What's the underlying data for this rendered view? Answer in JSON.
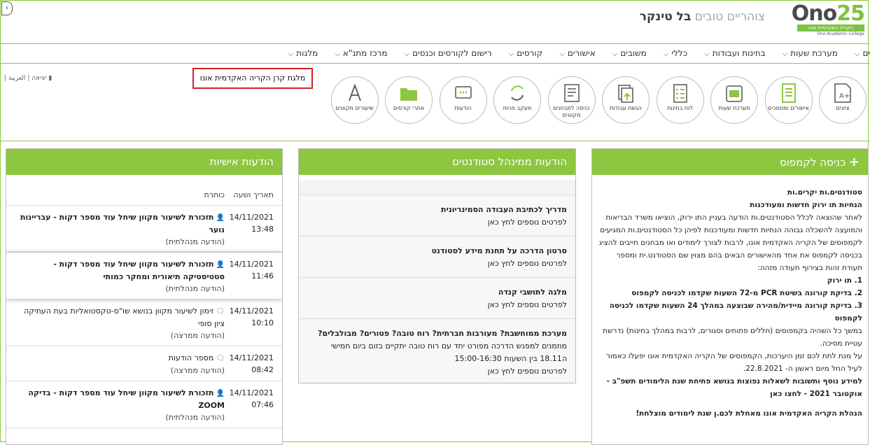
{
  "header": {
    "greeting": "צוהריים טובים",
    "user_name": "בל טינקר",
    "logo_main": "Ono",
    "logo_num": "25",
    "logo_band": "הקריה האקדמית אונו",
    "logo_sub": "Ono Academic College",
    "back_icon": "arrow-icon"
  },
  "nav": {
    "items": [
      "ציונים",
      "מערכת שעות",
      "בחינות ועבודות",
      "כללי",
      "משובים",
      "אישורים",
      "קורסים",
      "רישום לקורסים וכנסים",
      "מרכז מתנ\"א",
      "מלגות"
    ]
  },
  "tools": {
    "items": [
      {
        "label": "ציונים",
        "icon": "grades-icon"
      },
      {
        "label": "אישורים ומסמכים",
        "icon": "documents-icon"
      },
      {
        "label": "מערכת שעות",
        "icon": "timetable-icon"
      },
      {
        "label": "לוח בחינות",
        "icon": "exam-board-icon"
      },
      {
        "label": "הגשת עבודות",
        "icon": "submit-work-icon"
      },
      {
        "label": "כניסה למבחנים מקוונים",
        "icon": "online-exam-icon"
      },
      {
        "label": "מעקב פניות",
        "icon": "requests-tracking-icon"
      },
      {
        "label": "הודעות",
        "icon": "messages-icon"
      },
      {
        "label": "אתרי קורסים",
        "icon": "folder-icon"
      },
      {
        "label": "שיעורים מקוונים",
        "icon": "online-lessons-icon"
      }
    ],
    "langs": "יציאה | العربية |",
    "popup": "מלגת קרן הקריה האקדמית אונו"
  },
  "personal": {
    "title": "הודעות אישיות",
    "col_date": "תאריך ושעה",
    "col_title": "כותרת",
    "rows": [
      {
        "date": "14/11/2021",
        "time": "13:48",
        "title": "תזכורת לשיעור מקוון שיחל עוד מספר דקות - עבריינות נוער",
        "tag": "(הודעה מנהלתית)",
        "bold": true
      },
      {
        "date": "14/11/2021",
        "time": "11:46",
        "title": "תזכורת לשיעור מקוון שיחל עוד מספר דקות - סטטיסטיקה תיאורית ומחקר כמותי",
        "tag": "(הודעה מנהלתית)",
        "bold": true
      },
      {
        "date": "14/11/2021",
        "time": "10:10",
        "title": "זימון לשיעור מקוון בנושא שו\"ס-טקסטואליות בעת העתיקה ציון סופי",
        "tag": "(הודעה ממרצה)",
        "bold": false
      },
      {
        "date": "14/11/2021",
        "time": "08:42",
        "title": "מספר הודעות",
        "tag": "(הודעה ממרצה)",
        "bold": false
      },
      {
        "date": "14/11/2021",
        "time": "07:46",
        "title": "תזכורת לשיעור מקוון שיחל עוד מספר דקות - בדיקה ZOOM",
        "tag": "(הודעה מנהלתית)",
        "bold": true
      }
    ]
  },
  "manager": {
    "title": "הודעות ממינהל סטודנטים",
    "items": [
      {
        "title": "מדריך לכתיבת העבודה הסמינריונית",
        "body": "",
        "link": "לפרטים נוספים לחץ כאן"
      },
      {
        "title": "סרטון הדרכה על תחנת מידע לסטודנט",
        "body": "",
        "link": "לפרטים נוספים לחץ כאן"
      },
      {
        "title": "מלגה לתושבי קנדה",
        "body": "",
        "link": "לפרטים נוספים לחץ כאן"
      },
      {
        "title": "מערכת ממוחשבת? מעורבות חברתית? רוח טובה? פטורים? מבולבלים?",
        "body": "מוזמנים למפגש הדרכה מפורט יחד עם רוח טובה יתקיים בזום ביום חמישי ה18.11 בין השעות 15:00-16:30",
        "link": "לפרטים נוספים לחץ כאן"
      }
    ]
  },
  "campus": {
    "title": "כניסה לקמפוס",
    "l1": "סטודנטים.ות יקרים.ות",
    "l2": "הנחיות תו ירוק חדשות ומעודכנות",
    "l3": "לאחר שהוצאה לכלל הסטודנטים.ות הודעה בעניין התו ירוק, הוציאו משרד הבריאות והמועצה להשכלה גבוהה הנחיות חדשות ומעודכנות לפיהן כל הסטודנטים.ות המגיעים לקמפוסים של הקריה האקדמית אונו, לרבות לצורך לימודים ואו מבחנים חייבים להציג בכניסה לקמפוס את אחד מהאישורים הבאים בהם מצוין שם הסטודנט.ית ומספר תעודת זהות בצירוף תעודה מזהה:",
    "i1": "1. תו ירוק",
    "i2": "2. בדיקת קורונה בשיטת PCR מ-72 השעות שקדמו לכניסה לקמפוס",
    "i3": "3. בדיקת קורונה מיידית/מהירה שבוצעה במהלך 24 השעות שקדמו לכניסה לקמפוס",
    "l4": "במשך כל השהיה בקמפוסים (חללים פתוחים וסגורים, לרבות במהלך בחינות) נדרשת עטיית מסיכה.",
    "l5": "על מנת לתת לכם זמן היערכות, הקמפוסים של הקריה האקדמית אונו יפעלו כאמור לעיל החל מיום ראשון ה- 22.8.2021.",
    "l6": "למידע נוסף ותשובות לשאלות נפוצות בנושא פתיחת שנת הלימודים תשפ\"ב - אוקטובר 2021 - לחצו כאן",
    "l7": "הנהלת הקריה האקדמית אונו מאחלת לכם.ן שנת לימודים מוצלחת!"
  }
}
